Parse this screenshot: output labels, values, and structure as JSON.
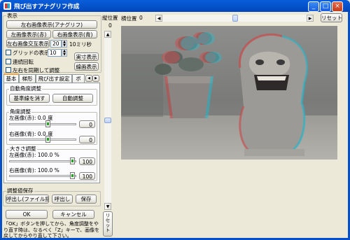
{
  "window": {
    "title": "飛び出すアナグリフ作成",
    "buttons": [
      "minimize",
      "maximize",
      "close"
    ]
  },
  "display_group": {
    "label": "表示",
    "anaglyph_button": "左右画像表示(アナグリフ)",
    "left_image_button": "左画像表示(赤)",
    "right_image_button": "右画像表示(青)",
    "alternate_button": "左右画像交互表示",
    "alternate_ms": "20",
    "alternate_unit": "10ミリ秒",
    "grid_checkbox": "グリッドの表示",
    "grid_value": "10",
    "fullsize_button": "実寸表示",
    "continuous_rotate_checkbox": "連続回転",
    "line_display_button": "線画表示",
    "sync_lr_checkbox": "左右を同期して調整"
  },
  "tabs": [
    "基本",
    "梯形",
    "飛び出す設定",
    "ボ"
  ],
  "auto_angle": {
    "label": "自動角度調整",
    "clear_button": "基準線を消す",
    "auto_button": "自動調整"
  },
  "angle": {
    "label": "角度調整",
    "left_label": "左画像(赤): 0.0 度",
    "left_value": "0",
    "right_label": "右画像(青): 0.0 度",
    "right_value": "0",
    "left_fraction": 0.0,
    "right_fraction": 0.0
  },
  "size": {
    "label": "大きさ調整",
    "left_label": "左画像(赤): 100.0 %",
    "left_value": "100",
    "right_label": "右画像(青): 100.0 %",
    "right_value": "100"
  },
  "save_group": {
    "label": "調整値保存",
    "load_file_button": "呼出し(ファイル指定)",
    "load_button": "呼出し",
    "save_button": "保存"
  },
  "ok_button": "OK",
  "cancel_button": "キャンセル",
  "help_text": "「OK」ボタンを押してから、角度調整をやり直す時は、なるべく「Z」キーで、画像を戻してからやり直して下さい。",
  "vertical_position": {
    "label": "縦位置",
    "value": "0"
  },
  "horizontal_position": {
    "label": "横位置",
    "value": "0"
  },
  "reset_button": "リセット",
  "reset_vertical_button": "リセット"
}
